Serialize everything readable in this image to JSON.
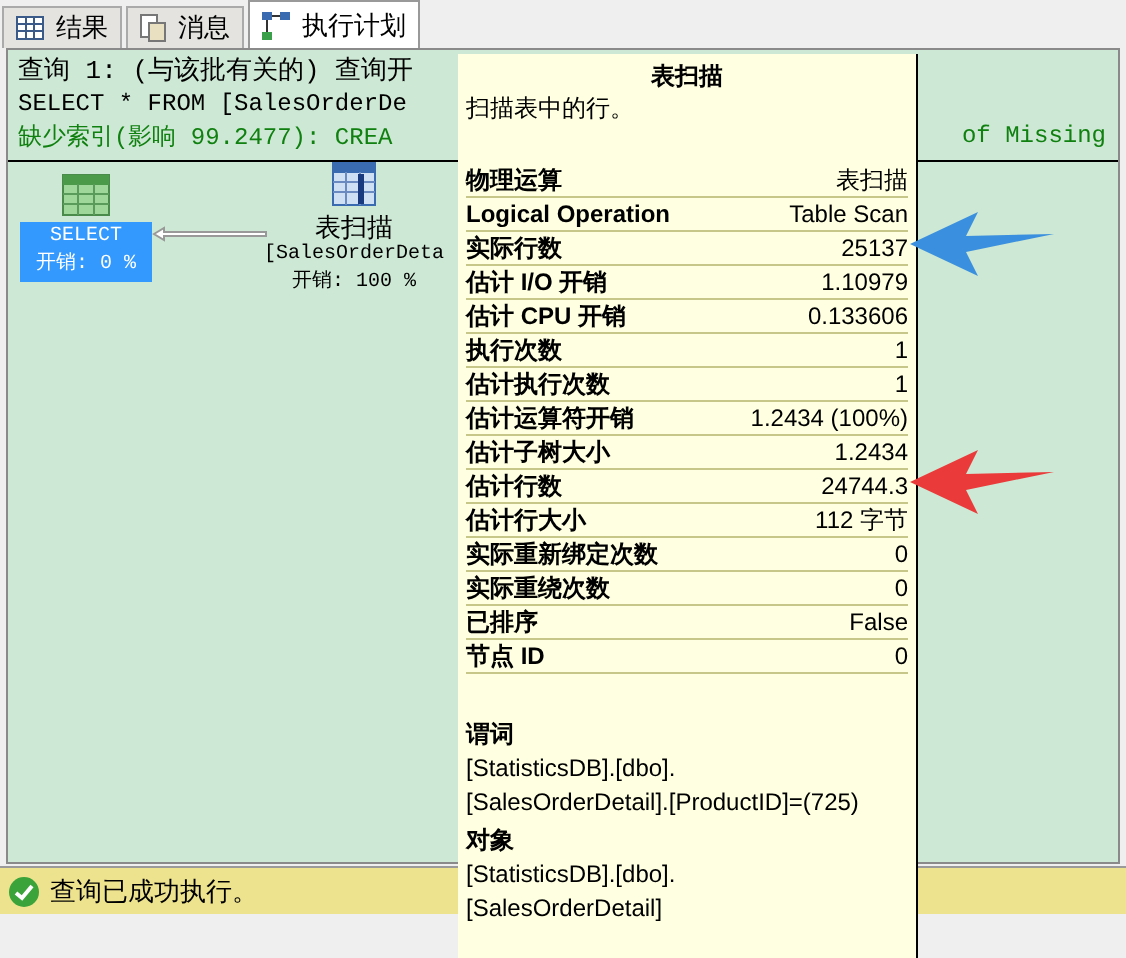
{
  "tabs": [
    {
      "label": "结果",
      "kind": "grid",
      "selected": false
    },
    {
      "label": "消息",
      "kind": "doc",
      "selected": false
    },
    {
      "label": "执行计划",
      "kind": "plan",
      "selected": true
    }
  ],
  "header": {
    "query": "查询 1: (与该批有关的) 查询开",
    "sql": "SELECT * FROM [SalesOrderDe",
    "missing_index": "缺少索引(影响 99.2477): CREA",
    "missing_index_tail": "of Missing"
  },
  "nodes": [
    {
      "kind": "select",
      "lines": [
        "SELECT",
        "开销: 0 %"
      ],
      "selected": true
    },
    {
      "kind": "scan",
      "lines": [
        "表扫描",
        "[SalesOrderDeta",
        "开销: 100 %"
      ],
      "selected": false
    }
  ],
  "tooltip": {
    "title": "表扫描",
    "description": "扫描表中的行。",
    "rows": [
      {
        "label": "物理运算",
        "value": "表扫描"
      },
      {
        "label": "Logical Operation",
        "value": "Table Scan"
      },
      {
        "label": "实际行数",
        "value": "25137",
        "color": "#3a8fde"
      },
      {
        "label": "估计 I/O 开销",
        "value": "1.10979"
      },
      {
        "label": "估计 CPU 开销",
        "value": "0.133606"
      },
      {
        "label": "执行次数",
        "value": "1"
      },
      {
        "label": "估计执行次数",
        "value": "1"
      },
      {
        "label": "估计运算符开销",
        "value": "1.2434 (100%)"
      },
      {
        "label": "估计子树大小",
        "value": "1.2434"
      },
      {
        "label": "估计行数",
        "value": "24744.3",
        "color": "#ea3a3a"
      },
      {
        "label": "估计行大小",
        "value": "112 字节"
      },
      {
        "label": "实际重新绑定次数",
        "value": "0"
      },
      {
        "label": "实际重绕次数",
        "value": "0"
      },
      {
        "label": "已排序",
        "value": "False"
      },
      {
        "label": "节点 ID",
        "value": "0"
      }
    ],
    "sections": [
      {
        "heading": "谓词",
        "lines": [
          "[StatisticsDB].[dbo].",
          "[SalesOrderDetail].[ProductID]=(725)"
        ]
      },
      {
        "heading": "对象",
        "lines": [
          "[StatisticsDB].[dbo].",
          "[SalesOrderDetail]"
        ]
      }
    ]
  },
  "status": {
    "text": "查询已成功执行。"
  }
}
